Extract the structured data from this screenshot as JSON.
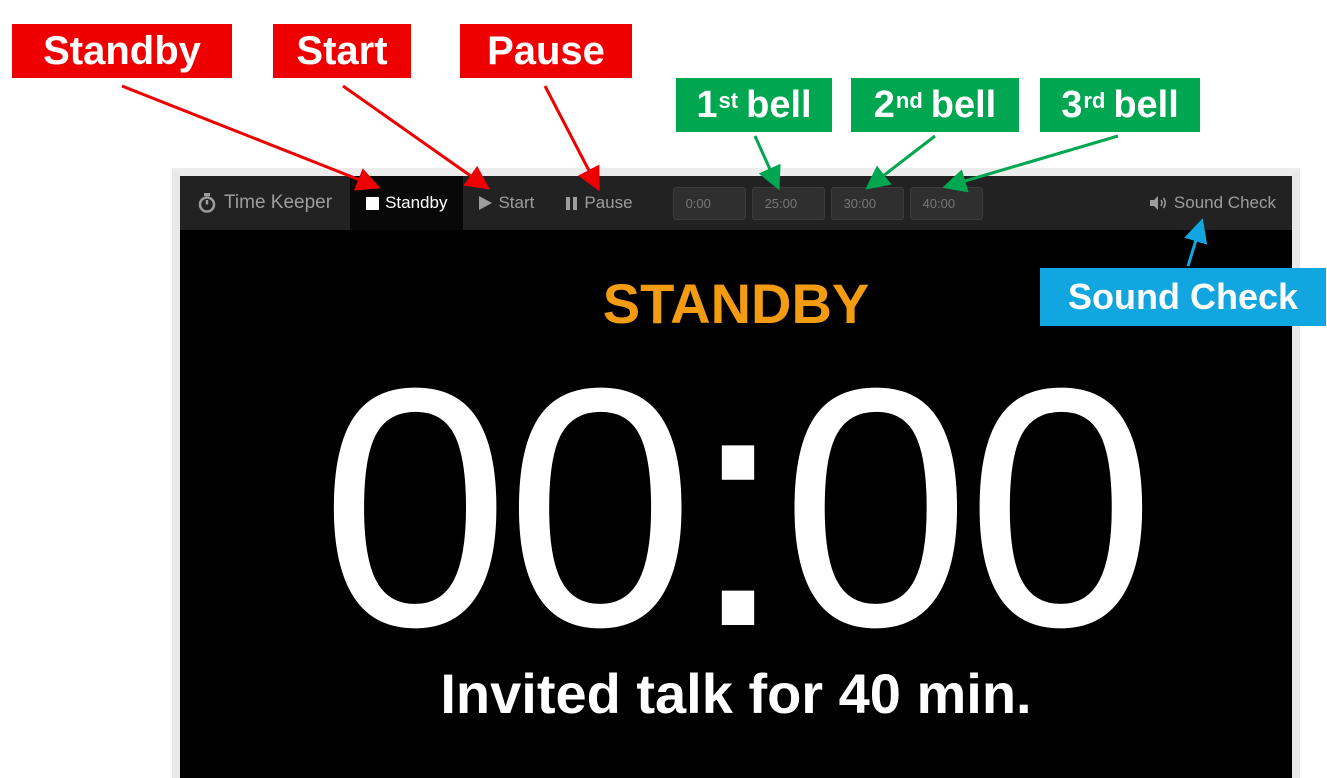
{
  "annotations": {
    "standby": "Standby",
    "start": "Start",
    "pause": "Pause",
    "bell1": {
      "num": "1",
      "suffix": "st",
      "word": "bell"
    },
    "bell2": {
      "num": "2",
      "suffix": "nd",
      "word": "bell"
    },
    "bell3": {
      "num": "3",
      "suffix": "rd",
      "word": "bell"
    },
    "sound_check": "Sound Check",
    "colors": {
      "red": "#ee0000",
      "green": "#00a650",
      "blue": "#12a6e0"
    }
  },
  "navbar": {
    "brand": "Time Keeper",
    "brand_icon": "stopwatch-icon",
    "items": [
      {
        "label": "Standby",
        "icon": "stop-icon",
        "active": true
      },
      {
        "label": "Start",
        "icon": "play-icon",
        "active": false
      },
      {
        "label": "Pause",
        "icon": "pause-icon",
        "active": false
      }
    ],
    "bells": [
      "0:00",
      "25:00",
      "30:00",
      "40:00"
    ],
    "sound_check": "Sound Check",
    "sound_icon": "speaker-icon"
  },
  "display": {
    "status": "STANDBY",
    "status_color": "#f39c12",
    "time": "00:00",
    "caption": "Invited talk for 40 min."
  }
}
